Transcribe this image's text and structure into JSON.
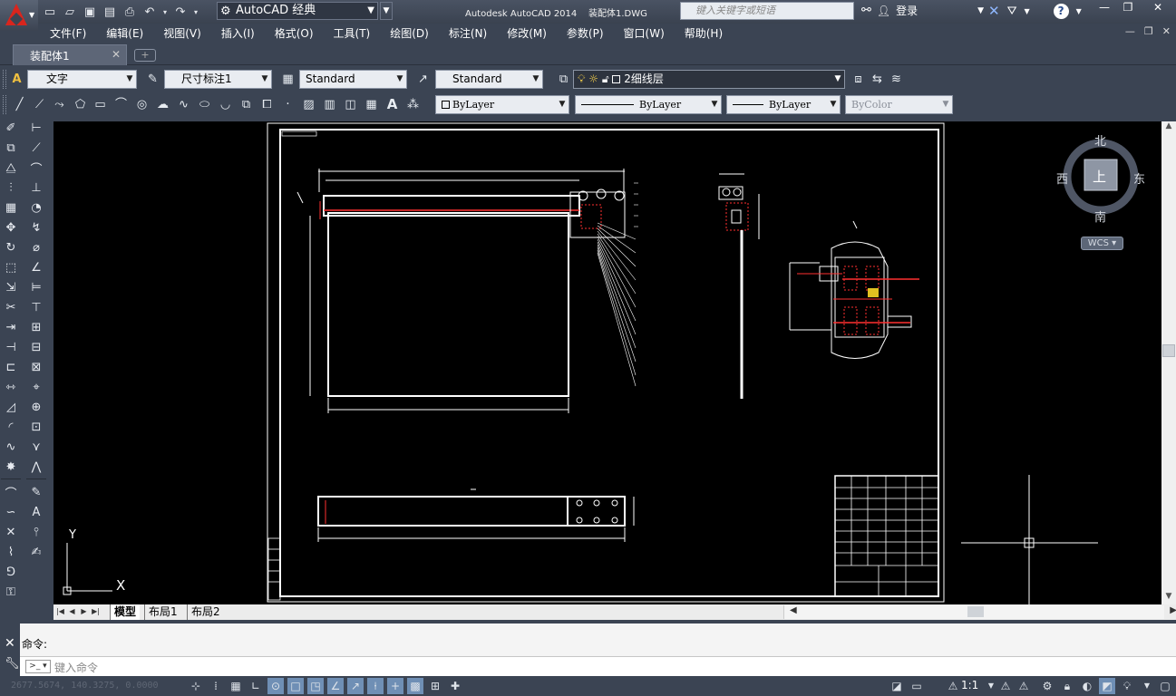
{
  "titlebar": {
    "workspace": "AutoCAD 经典",
    "title": "Autodesk AutoCAD 2014    装配体1.DWG",
    "search_placeholder": "键入关键字或短语",
    "login": "登录"
  },
  "menu": {
    "items": [
      "文件(F)",
      "编辑(E)",
      "视图(V)",
      "插入(I)",
      "格式(O)",
      "工具(T)",
      "绘图(D)",
      "标注(N)",
      "修改(M)",
      "参数(P)",
      "窗口(W)",
      "帮助(H)"
    ]
  },
  "doc_tab": {
    "label": "装配体1"
  },
  "styles_toolbar": {
    "text_style": "文字",
    "dim_style": "尺寸标注1",
    "table_style": "Standard",
    "multileader_style": "Standard",
    "layer": "2细线层"
  },
  "properties_toolbar": {
    "color": "ByLayer",
    "linetype": "ByLayer",
    "lineweight": "ByLayer",
    "plotstyle": "ByColor"
  },
  "viewcube": {
    "north": "北",
    "south": "南",
    "west": "西",
    "east": "东",
    "face": "上",
    "wcs": "WCS"
  },
  "ucs": {
    "x": "X",
    "y": "Y"
  },
  "layout_tabs": [
    "模型",
    "布局1",
    "布局2"
  ],
  "command": {
    "history": "命令:",
    "placeholder": "键入命令"
  },
  "status": {
    "coords": "2677.5674, 140.3275, 0.0000",
    "annotation_scale": "1:1"
  },
  "colors": {
    "chrome": "#3b4453",
    "canvas": "#000000",
    "accent_red": "#ff3030"
  }
}
